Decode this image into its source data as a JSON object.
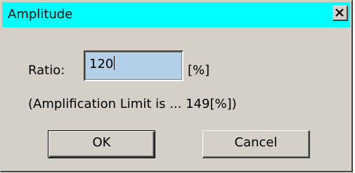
{
  "window": {
    "title": "Amplitude",
    "titlebar_color": "#00ffff",
    "close_icon": "close-icon"
  },
  "form": {
    "ratio_label": "Ratio:",
    "ratio_value": "120",
    "ratio_unit": "[%]",
    "limit_note": "(Amplification Limit is ... 149[%])"
  },
  "buttons": {
    "ok_label": "OK",
    "cancel_label": "Cancel"
  }
}
